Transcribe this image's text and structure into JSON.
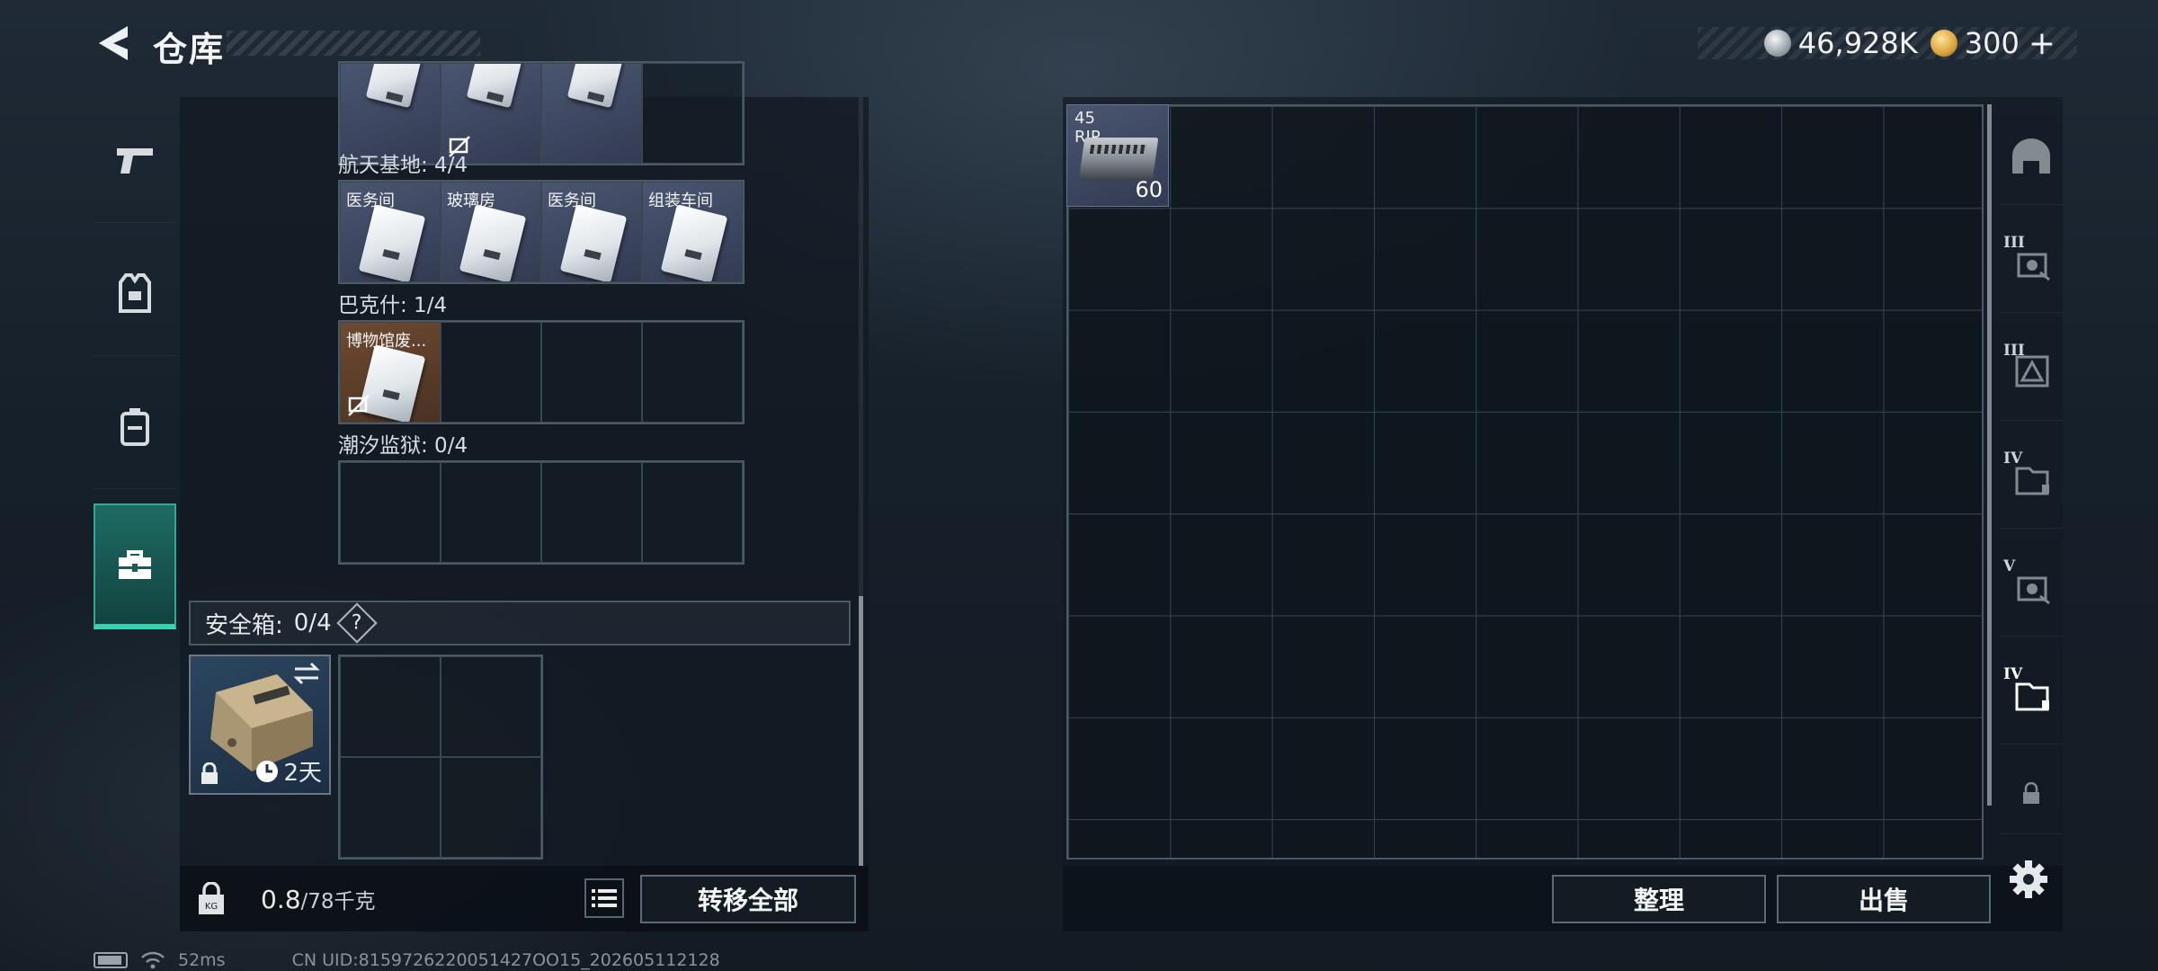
{
  "header": {
    "title": "仓库",
    "silver_amount": "46,928K",
    "gold_amount": "300",
    "gold_plus": "+"
  },
  "left_nav": {
    "items": [
      {
        "name": "weapons",
        "icon": "pistol-icon"
      },
      {
        "name": "armor",
        "icon": "vest-icon"
      },
      {
        "name": "backpack",
        "icon": "backpack-icon"
      },
      {
        "name": "toolbox",
        "icon": "toolbox-icon",
        "active": true
      }
    ]
  },
  "keycard_sections": [
    {
      "label": "航天基地: 4/4",
      "cards": [
        "医务间",
        "玻璃房",
        "医务间",
        "组装车间"
      ]
    },
    {
      "label": "巴克什: 1/4",
      "cards": [
        "博物馆废..."
      ]
    },
    {
      "label": "潮汐监狱: 0/4",
      "cards": []
    }
  ],
  "safe_box": {
    "label": "安全箱:",
    "count": "0/4",
    "help": "?",
    "duration": "2天"
  },
  "weight": {
    "current": "0.8",
    "max": "/78千克"
  },
  "buttons": {
    "transfer_all": "转移全部",
    "sort": "整理",
    "sell": "出售"
  },
  "stash": {
    "ammo_label_line1": "45",
    "ammo_label_line2": "RIP",
    "ammo_count": "60"
  },
  "right_tabs": [
    {
      "name": "helmet",
      "tier": ""
    },
    {
      "name": "tier-3-keycards",
      "tier": "III"
    },
    {
      "name": "tier-3-vest",
      "tier": "III"
    },
    {
      "name": "tier-4-folder",
      "tier": "IV"
    },
    {
      "name": "tier-5-keycards",
      "tier": "V"
    },
    {
      "name": "tier-4-folder-active",
      "tier": "IV",
      "active": true
    },
    {
      "name": "lock",
      "tier": ""
    }
  ],
  "status": {
    "ping": "52ms",
    "uid": "CN UID:8159726220051427OO15_202605112128"
  },
  "colors": {
    "accent": "#3ad0b0",
    "panel_bg": "#121a22",
    "card_bg": "#3b4460"
  }
}
